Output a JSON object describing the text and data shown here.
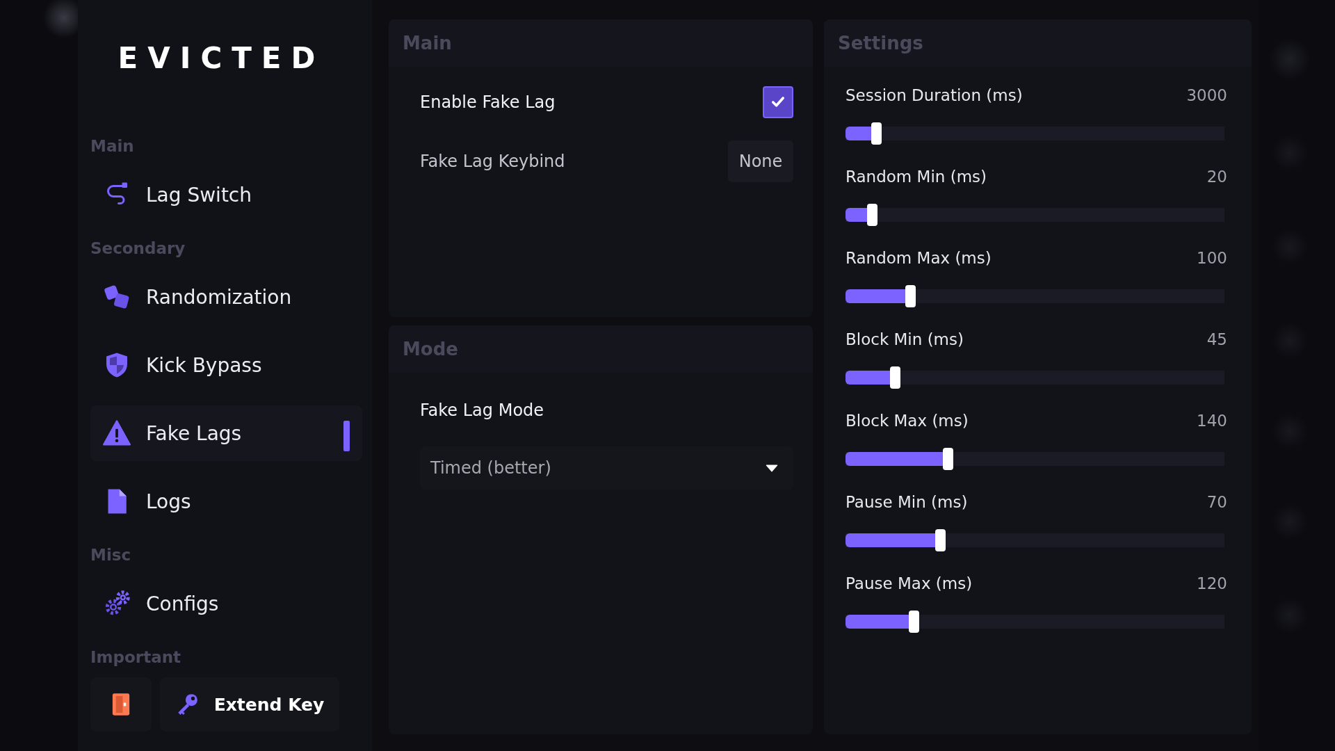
{
  "app": {
    "logo": "EVICTED"
  },
  "sidebar": {
    "groups": [
      {
        "title": "Main",
        "items": [
          {
            "label": "Lag Switch",
            "selected": false
          }
        ]
      },
      {
        "title": "Secondary",
        "items": [
          {
            "label": "Randomization",
            "selected": false
          },
          {
            "label": "Kick Bypass",
            "selected": false
          },
          {
            "label": "Fake Lags",
            "selected": true
          },
          {
            "label": "Logs",
            "selected": false
          }
        ]
      },
      {
        "title": "Misc",
        "items": [
          {
            "label": "Configs",
            "selected": false
          }
        ]
      },
      {
        "title": "Important",
        "buttons": [
          {
            "kind": "icon"
          },
          {
            "kind": "labeled",
            "label": "Extend Key"
          }
        ]
      }
    ]
  },
  "main_panel": {
    "title": "Main",
    "enable": {
      "label": "Enable Fake Lag",
      "checked": true
    },
    "keybind": {
      "label": "Fake Lag Keybind",
      "value": "None"
    }
  },
  "mode_panel": {
    "title": "Mode",
    "label": "Fake Lag Mode",
    "dropdown": {
      "value": "Timed (better)"
    }
  },
  "settings_panel": {
    "title": "Settings",
    "sliders": [
      {
        "name": "Session Duration (ms)",
        "reading": "3000",
        "level": 0.08
      },
      {
        "name": "Random Min (ms)",
        "reading": "20",
        "level": 0.07
      },
      {
        "name": "Random Max (ms)",
        "reading": "100",
        "level": 0.17
      },
      {
        "name": "Block Min (ms)",
        "reading": "45",
        "level": 0.13
      },
      {
        "name": "Block Max (ms)",
        "reading": "140",
        "level": 0.27
      },
      {
        "name": "Pause Min (ms)",
        "reading": "70",
        "level": 0.25
      },
      {
        "name": "Pause Max (ms)",
        "reading": "120",
        "level": 0.18
      }
    ]
  }
}
